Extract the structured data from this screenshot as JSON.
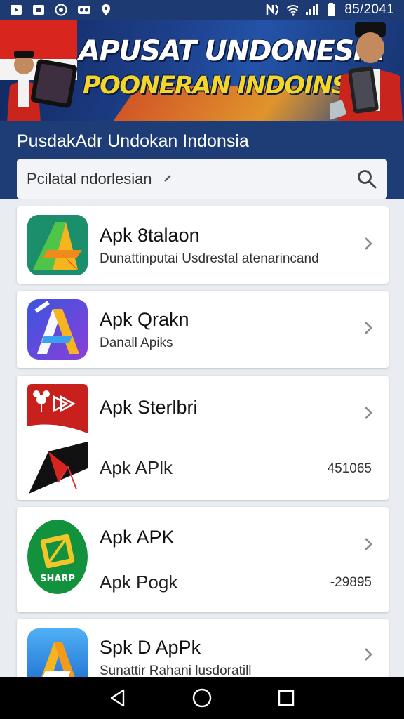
{
  "status_bar": {
    "time": "85/2041",
    "icons": [
      "media-icon",
      "image-icon",
      "vpn-icon",
      "voicemail-icon",
      "location-icon",
      "nfc-icon",
      "wifi-icon",
      "signal-icon",
      "battery-icon"
    ]
  },
  "banner": {
    "title": "APUSAT UNDONESIA",
    "subtitle": "POONERAN INDOINSIA",
    "colors": {
      "title": "#ffffff",
      "subtitle": "#f4d52a",
      "flag_red": "#d8261f",
      "stripe": "#f59b1e"
    }
  },
  "header": {
    "title": "PusdakAdr Undokan Indonsia",
    "background": "#1e3c75"
  },
  "search": {
    "value": "Pcilatal ndorlesian",
    "icon": "search-icon"
  },
  "apps": [
    {
      "title": "Apk 8talaon",
      "subtitle": "Dunattinputai Usdrestal atenarincand",
      "icon": "green-a-icon"
    },
    {
      "title": "Apk Qrakn",
      "subtitle": "Danall Apiks",
      "icon": "purple-a-icon"
    },
    {
      "title": "Apk Sterlbri",
      "subtitle": "Apk APlk",
      "count": "451065",
      "icon": "red-flag-icon"
    },
    {
      "title": "Apk APK",
      "subtitle": "Apk Pogk",
      "count": "-29895",
      "icon": "sharp-icon"
    },
    {
      "title": "Spk D ApPk",
      "subtitle": "Sunattir Rahani lusdoratill",
      "icon": "blue-a-icon"
    }
  ],
  "nav": [
    "back-icon",
    "home-icon",
    "recents-icon"
  ]
}
